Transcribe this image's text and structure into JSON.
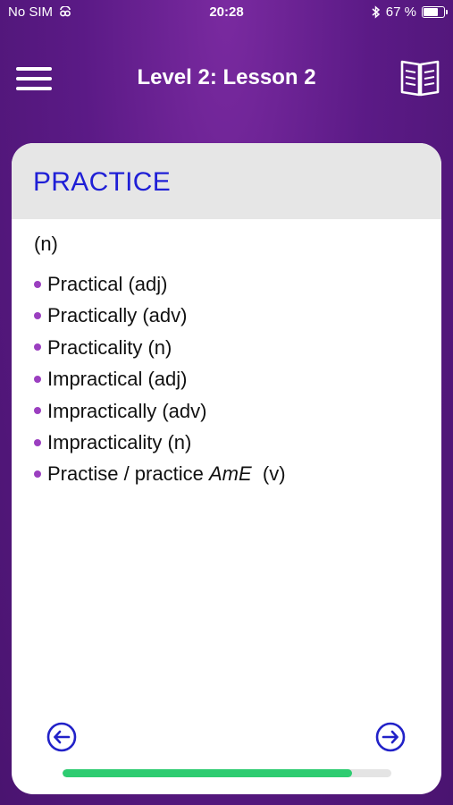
{
  "status_bar": {
    "carrier": "No SIM",
    "time": "20:28",
    "battery_percent": "67 %",
    "battery_level": 0.67
  },
  "header": {
    "title": "Level 2: Lesson 2",
    "menu_icon": "hamburger-menu-icon",
    "book_icon": "book-icon"
  },
  "card": {
    "word": "PRACTICE",
    "part_of_speech": "(n)",
    "forms": [
      "Practical (adj)",
      "Practically (adv)",
      "Practicality (n)",
      "Impractical (adj)",
      "Impractically (adv)",
      "Impracticality (n)"
    ],
    "last_form": {
      "prefix": "Practise / practice ",
      "variant": "AmE",
      "suffix": "  (v)"
    }
  },
  "footer": {
    "progress_fraction": 0.88
  },
  "colors": {
    "background": "#5b1a86",
    "title_blue": "#1f1fd6",
    "bullet_purple": "#9b3fc0",
    "progress_green": "#2ecc71",
    "nav_blue": "#2222c8"
  }
}
